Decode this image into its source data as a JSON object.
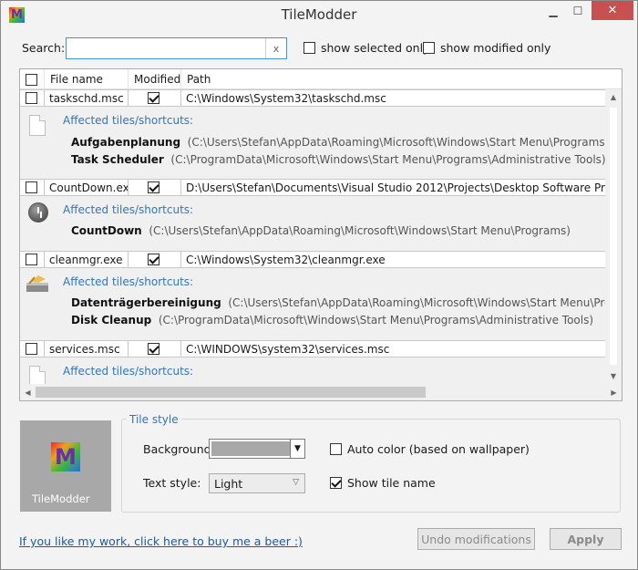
{
  "window": {
    "title": "TileModder",
    "logo_letter": "M",
    "close_glyph": "✕",
    "min_glyph": "▁",
    "max_glyph": "☐"
  },
  "search": {
    "label": "Search:",
    "value": "",
    "placeholder": "",
    "clear_label": "x"
  },
  "filters": {
    "show_selected_only": "show selected only",
    "show_modified_only": "show modified only"
  },
  "table": {
    "columns": [
      "File name",
      "Modified",
      "Path"
    ],
    "affected_label": "Affected tiles/shortcuts:",
    "rows": [
      {
        "name": "taskschd.msc",
        "modified": true,
        "path": "C:\\Windows\\System32\\taskschd.msc",
        "icon": "document-icon",
        "tiles": [
          {
            "name": "Aufgabenplanung",
            "path": "(C:\\Users\\Stefan\\AppData\\Roaming\\Microsoft\\Windows\\Start Menu\\Programs)"
          },
          {
            "name": "Task Scheduler",
            "path": "(C:\\ProgramData\\Microsoft\\Windows\\Start Menu\\Programs\\Administrative Tools)"
          }
        ]
      },
      {
        "name": "CountDown.exe",
        "modified": true,
        "path": "D:\\Users\\Stefan\\Documents\\Visual Studio 2012\\Projects\\Desktop Software Projects\\Cou",
        "icon": "clock-icon",
        "tiles": [
          {
            "name": "CountDown",
            "path": "(C:\\Users\\Stefan\\AppData\\Roaming\\Microsoft\\Windows\\Start Menu\\Programs)"
          }
        ]
      },
      {
        "name": "cleanmgr.exe",
        "modified": true,
        "path": "C:\\Windows\\System32\\cleanmgr.exe",
        "icon": "disk-cleanup-icon",
        "tiles": [
          {
            "name": "Datenträgerbereinigung",
            "path": "(C:\\Users\\Stefan\\AppData\\Roaming\\Microsoft\\Windows\\Start Menu\\Programs)"
          },
          {
            "name": "Disk Cleanup",
            "path": "(C:\\ProgramData\\Microsoft\\Windows\\Start Menu\\Programs\\Administrative Tools)"
          }
        ]
      },
      {
        "name": "services.msc",
        "modified": true,
        "path": "C:\\WINDOWS\\system32\\services.msc",
        "icon": "document-icon",
        "tiles": []
      }
    ]
  },
  "preview": {
    "tile_name": "TileModder",
    "tile_color": "#a8a8a8"
  },
  "tile_style": {
    "group_title": "Tile style",
    "background_label": "Background:",
    "background_color": "#a8a8a8",
    "auto_color_label": "Auto color (based on wallpaper)",
    "auto_color_checked": false,
    "text_style_label": "Text style:",
    "text_style_value": "Light",
    "show_name_label": "Show tile name",
    "show_name_checked": true
  },
  "footer": {
    "link_text": "If you like my work, click here to buy me a beer :)",
    "undo_label": "Undo modifications",
    "apply_label": "Apply"
  },
  "colors": {
    "accent": "#3275b8",
    "close": "#c75050",
    "detail_bg": "#f0f0f0"
  }
}
